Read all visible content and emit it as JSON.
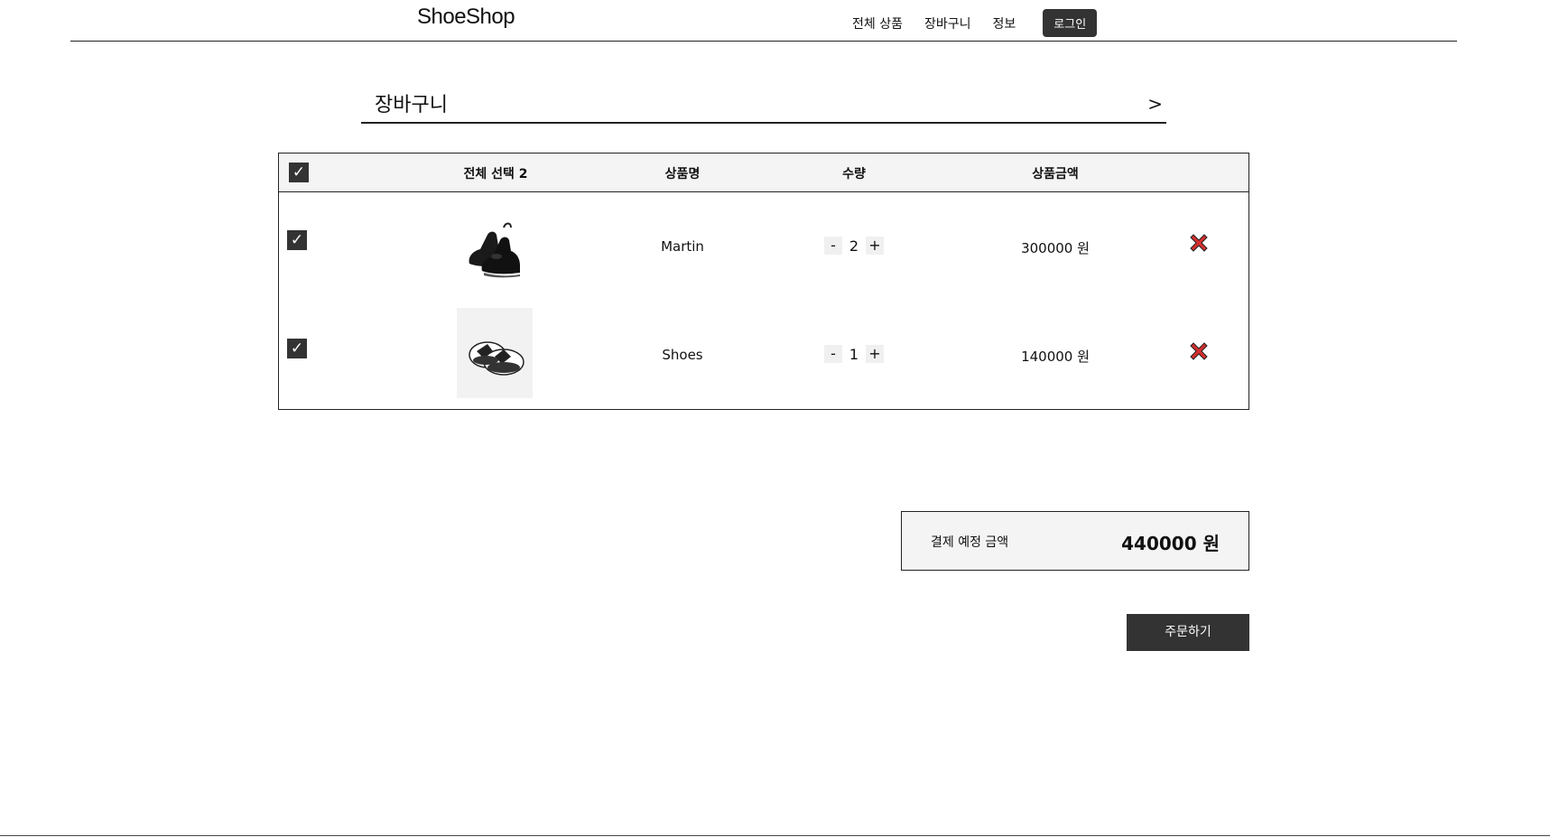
{
  "header": {
    "logo": "ShoeShop",
    "nav": [
      "전체 상품",
      "장바구니",
      "정보"
    ],
    "login_label": "로그인"
  },
  "cart": {
    "title": "장바구니",
    "arrow": ">"
  },
  "table": {
    "headers": {
      "select_all": "전체 선택 2",
      "name": "상품명",
      "quantity": "수량",
      "price": "상품금액"
    },
    "rows": [
      {
        "checked": true,
        "image": "black-chelsea-boot",
        "name": "Martin",
        "quantity": "2",
        "price": "300000 원"
      },
      {
        "checked": true,
        "image": "white-slide-sandal",
        "name": "Shoes",
        "quantity": "1",
        "price": "140000 원"
      }
    ],
    "check_glyph": "✓",
    "minus": "-",
    "plus": "+"
  },
  "summary": {
    "label": "결제 예정 금액",
    "amount": "440000 원"
  },
  "order_button": "주문하기",
  "colors": {
    "dark": "#333333",
    "header_bg": "#f4f4f4",
    "delete_red": "#d32f2f"
  }
}
